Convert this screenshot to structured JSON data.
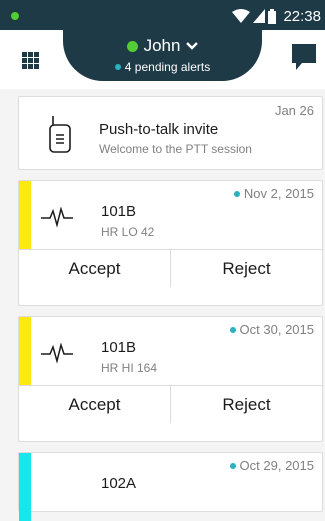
{
  "status_bar": {
    "time": "22:38"
  },
  "header": {
    "user_name": "John",
    "alerts_text": "4 pending alerts"
  },
  "invite": {
    "date": "Jan 26",
    "title": "Push-to-talk invite",
    "subtitle": "Welcome to the PTT session"
  },
  "alarms": [
    {
      "date": "Nov 2, 2015",
      "title": "101B",
      "subtitle": "HR LO 42",
      "stripe_color": "#fde90f",
      "accept": "Accept",
      "reject": "Reject"
    },
    {
      "date": "Oct 30, 2015",
      "title": "101B",
      "subtitle": "HR HI 164",
      "stripe_color": "#fde90f",
      "accept": "Accept",
      "reject": "Reject"
    },
    {
      "date": "Oct 29, 2015",
      "title": "102A",
      "stripe_color": "#18e6ef"
    }
  ],
  "colors": {
    "navy": "#1e3a46",
    "presence": "#55cc33",
    "alert_dot": "#2ab1c1"
  }
}
